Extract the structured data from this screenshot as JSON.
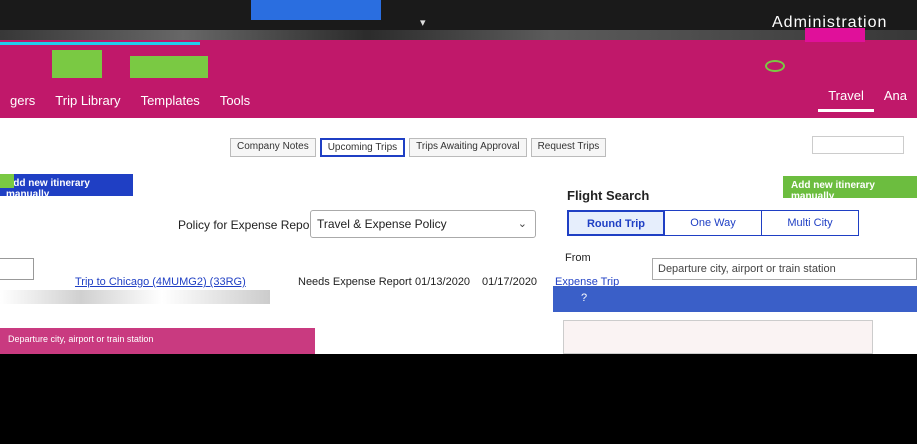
{
  "topbar": {
    "dropdown_label": "▾",
    "admin_label": "Administration"
  },
  "nav": {
    "items": [
      "gers",
      "Trip Library",
      "Templates",
      "Tools"
    ],
    "right_items": [
      "Travel",
      "Ana"
    ]
  },
  "tabs": [
    "Company Notes",
    "Upcoming Trips",
    "Trips Awaiting Approval",
    "Request Trips"
  ],
  "left": {
    "header": "Add new itinerary manually"
  },
  "policy": {
    "label": "Policy for Expense Reports",
    "value": "Travel & Expense Policy"
  },
  "trips": [
    {
      "name": "Trip to Chicago (4MUMG2) (33RG)",
      "status": "Needs Expense Report",
      "start": "01/13/2020",
      "end": "01/17/2020",
      "action": "Expense Trip"
    }
  ],
  "flight_search": {
    "title": "Flight Search",
    "add_button": "Add new itinerary manually",
    "trip_types": [
      "Round Trip",
      "One Way",
      "Multi City"
    ],
    "selected_trip_type": "Round Trip",
    "from_label": "From",
    "departure_placeholder": "Departure city, airport or train station"
  },
  "lower_left_text": "Departure city, airport or train station",
  "colors": {
    "brand": "#c0186a",
    "accent_blue": "#1f3fc4",
    "green": "#6cbd3f"
  }
}
